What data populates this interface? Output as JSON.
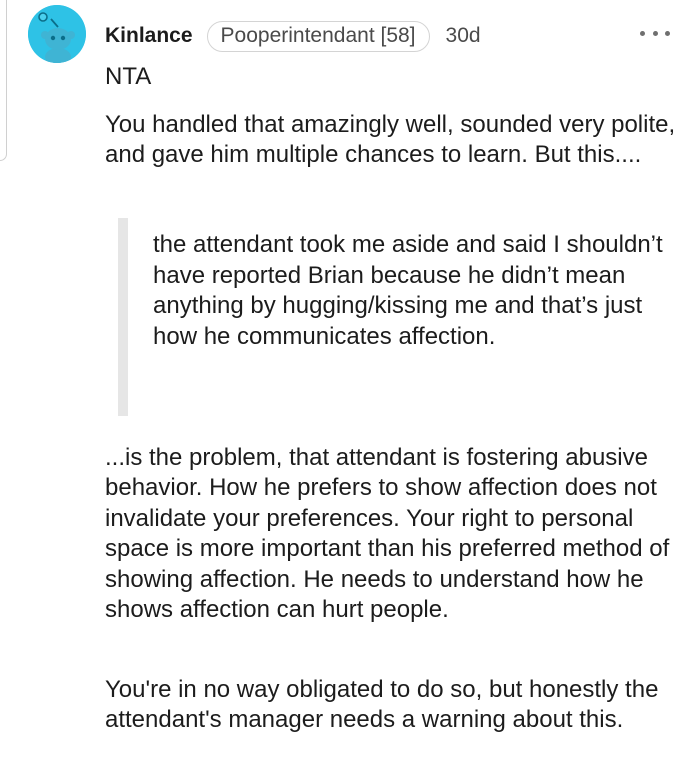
{
  "comment": {
    "username": "Kinlance",
    "flair": "Pooperintendant [58]",
    "age": "30d",
    "icons": {
      "avatar": "snoo-avatar",
      "more": "more-options-icon"
    },
    "colors": {
      "avatar_background": "#2ec2e6",
      "text": "#1c1c1c",
      "muted": "#4a4a4a"
    },
    "paragraphs": {
      "p1": "NTA",
      "p2": "You handled that amazingly well, sounded very polite, and gave him multiple chances to learn. But this....",
      "quote": "the attendant took me aside and said I shouldn’t have reported Brian because he didn’t mean anything by hugging/kissing me and that’s just how he communicates affection.",
      "p3": "...is the problem, that attendant is fostering abusive behavior. How he prefers to show affection does not invalidate your preferences. Your right to personal space is more important than his preferred method of showing affection. He needs to understand how he shows affection can hurt people.",
      "p4": "You're in no way obligated to do so, but honestly the attendant's manager needs a warning about this."
    }
  }
}
